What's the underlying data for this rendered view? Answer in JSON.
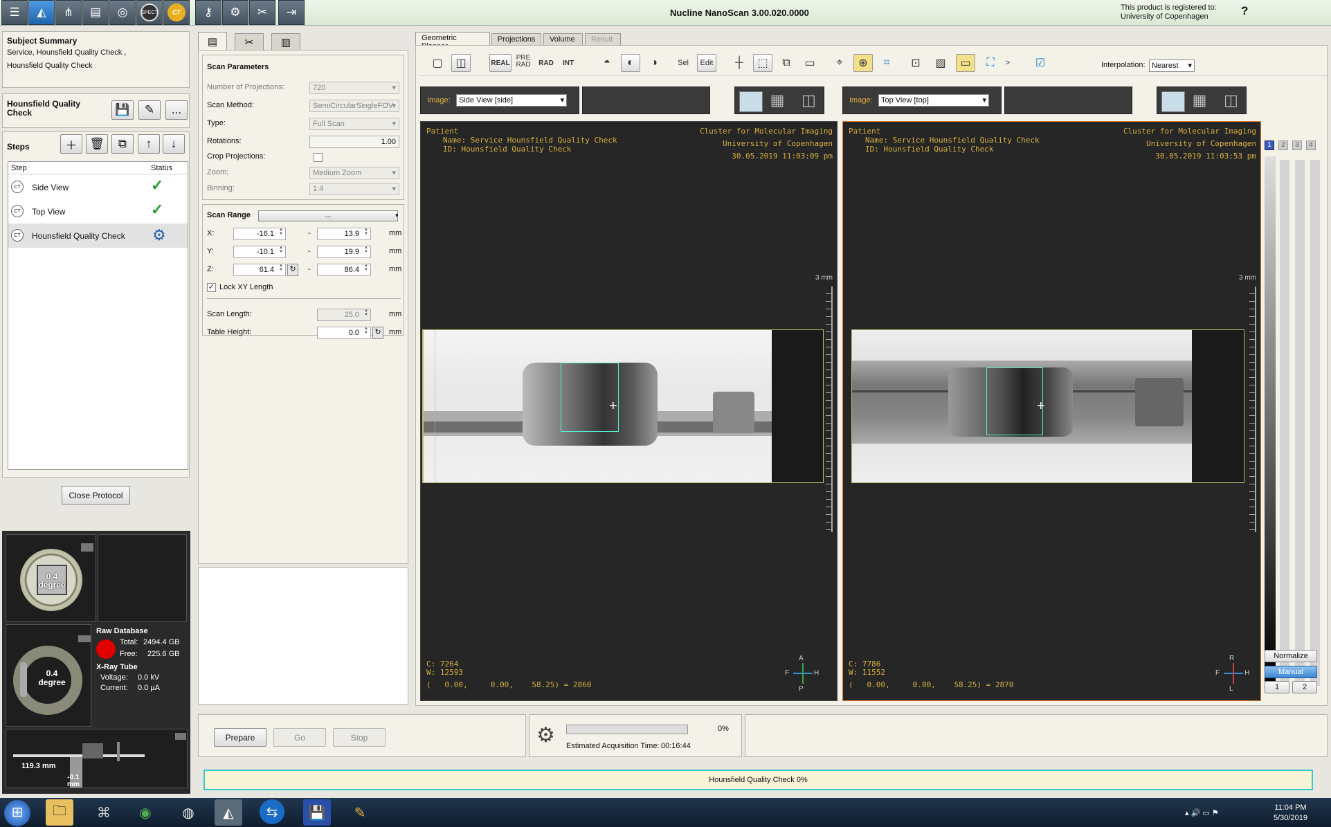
{
  "app": {
    "title": "Nucline NanoScan 3.00.020.0000",
    "registration_line1": "This product is registered to:",
    "registration_line2": "University of Copenhagen"
  },
  "toolbar": {
    "buttons": [
      {
        "name": "protocol-list-icon",
        "glyph": "☰"
      },
      {
        "name": "animal-bed-icon",
        "glyph": "🐁"
      },
      {
        "name": "hierarchy-icon",
        "glyph": "⊞"
      },
      {
        "name": "open-folder-icon",
        "glyph": "📂"
      },
      {
        "name": "ct-ring-icon",
        "glyph": "◎"
      },
      {
        "name": "spect-icon",
        "glyph": "SPECT"
      },
      {
        "name": "ct-gold-icon",
        "glyph": "CT"
      },
      {
        "name": "key-icon",
        "glyph": "🔑"
      },
      {
        "name": "settings-gear-icon",
        "glyph": "⚙"
      },
      {
        "name": "tools-icon",
        "glyph": "✂"
      },
      {
        "name": "exit-icon",
        "glyph": "⇥"
      }
    ]
  },
  "summary": {
    "title": "Subject Summary",
    "line1": "Service, Hounsfield Quality Check ,",
    "line2": "Hounsfield Quality Check"
  },
  "protocol": {
    "name_line1": "Hounsfield Quality",
    "name_line2": "Check",
    "more_label": "..."
  },
  "steps": {
    "title": "Steps",
    "col_step": "Step",
    "col_status": "Status",
    "items": [
      {
        "label": "Side View",
        "icon": "CT",
        "status": "done"
      },
      {
        "label": "Top View",
        "icon": "CT",
        "status": "done"
      },
      {
        "label": "Hounsfield Quality Check",
        "icon": "CT",
        "status": "in-progress"
      }
    ]
  },
  "close_protocol": "Close Protocol",
  "gantry": {
    "angle1": "0.4",
    "angle1_unit": "degree",
    "angle2": "0.4",
    "angle2_unit": "degree",
    "bed_position": "119.3 mm",
    "bed_height": "-0.1",
    "bed_height_unit": "mm"
  },
  "database": {
    "title": "Raw Database",
    "total_label": "Total:",
    "total": "2494.4 GB",
    "free_label": "Free:",
    "free": "225.6 GB",
    "status_color": "#e00000"
  },
  "xray": {
    "title": "X-Ray Tube",
    "voltage_label": "Voltage:",
    "voltage": "0.0 kV",
    "current_label": "Current:",
    "current": "0.0 µA"
  },
  "scan_params": {
    "title": "Scan Parameters",
    "projections_label": "Number of Projections:",
    "projections": "720",
    "method_label": "Scan Method:",
    "method": "SemiCircularSingleFOV",
    "type_label": "Type:",
    "type": "Full Scan",
    "rotations_label": "Rotations:",
    "rotations": "1.00",
    "crop_label": "Crop Projections:",
    "zoom_label": "Zoom:",
    "zoom": "Medium Zoom",
    "binning_label": "Binning:",
    "binning": "1:4"
  },
  "scan_range": {
    "title": "Scan Range",
    "combo": "...",
    "x_label": "X:",
    "x_from": "-16.1",
    "x_to": "13.9",
    "y_label": "Y:",
    "y_from": "-10.1",
    "y_to": "19.9",
    "z_label": "Z:",
    "z_from": "61.4",
    "z_to": "86.4",
    "dash": "-",
    "unit": "mm",
    "lock_label": "Lock XY Length",
    "length_label": "Scan Length:",
    "length": "25.0",
    "height_label": "Table Height:",
    "height": "0.0"
  },
  "planner": {
    "tabs": [
      "Geometric Planner",
      "Projections",
      "Volume",
      "Result"
    ],
    "tools": {
      "real": "REAL",
      "pre": "PRE",
      "rad_small": "RAD",
      "rad": "RAD",
      "int": "INT",
      "sel": "Sel",
      "edit": "Edit",
      "more": ">"
    },
    "interpolation_label": "Interpolation:",
    "interpolation": "Nearest"
  },
  "viewports": [
    {
      "image_label": "Image:",
      "image": "Side View [side]",
      "patient": "Patient",
      "name": "Name: Service Hounsfield Quality Check",
      "id": "ID: Hounsfield Quality Check",
      "institute": "Cluster for Molecular Imaging",
      "university": "University of Copenhagen",
      "datetime": "30.05.2019 11:03:09 pm",
      "scale": "3 mm",
      "c": "C: 7264",
      "w": "W: 12593",
      "probe": "(   0.00,     0.00,    58.25) = 2860",
      "orient_top": "A",
      "orient_left": "F",
      "orient_right": "H",
      "orient_bottom": "P"
    },
    {
      "image_label": "Image:",
      "image": "Top View [top]",
      "patient": "Patient",
      "name": "Name: Service Hounsfield Quality Check",
      "id": "ID: Hounsfield Quality Check",
      "institute": "Cluster for Molecular Imaging",
      "university": "University of Copenhagen",
      "datetime": "30.05.2019 11:03:53 pm",
      "scale": "3 mm",
      "c": "C: 7786",
      "w": "W: 11552",
      "probe": "(   0.00,     0.00,    58.25) = 2870",
      "orient_top": "R",
      "orient_left": "F",
      "orient_right": "H",
      "orient_bottom": "L"
    }
  ],
  "right_panel": {
    "pages": [
      "1",
      "2",
      "3",
      "4"
    ],
    "normalize": "Normalize",
    "manual": "Manual",
    "b1": "1",
    "b2": "2"
  },
  "acquisition": {
    "prepare": "Prepare",
    "go": "Go",
    "stop": "Stop",
    "progress_percent": 0,
    "progress_text": "0%",
    "eta_label": "Estimated Acquisition Time:",
    "eta": "00:16:44",
    "status": "Hounsfield Quality Check 0%"
  },
  "taskbar": {
    "time": "11:04 PM",
    "date": "5/30/2019"
  },
  "colors": {
    "overlay_text": "#d7b040",
    "selected_viewport": "#e07a30",
    "accent_blue": "#2f6fd0"
  }
}
